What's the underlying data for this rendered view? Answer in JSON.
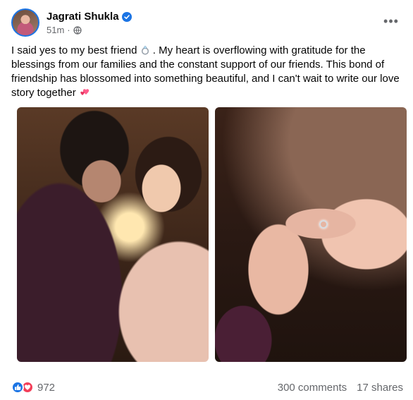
{
  "post": {
    "author": "Jagrati Shukla",
    "time": "51m",
    "caption_part1": "I said yes to my best friend ",
    "caption_part2": " . My heart is overflowing with gratitude for the blessings from our families and the constant support of our friends. This bond of friendship has blossomed into something beautiful, and I can't wait to write our love story together ",
    "reaction_count": "972",
    "comments": "300 comments",
    "shares": "17 shares"
  },
  "icons": {
    "verified": "verified-badge-icon",
    "audience": "globe-icon",
    "more": "more-options-icon",
    "ring": "ring-emoji-icon",
    "heart": "two-hearts-emoji-icon",
    "like": "like-reaction-icon",
    "love": "love-reaction-icon"
  },
  "colors": {
    "accent": "#1b74e4",
    "love": "#f33e58",
    "secondary_text": "#65676b"
  }
}
